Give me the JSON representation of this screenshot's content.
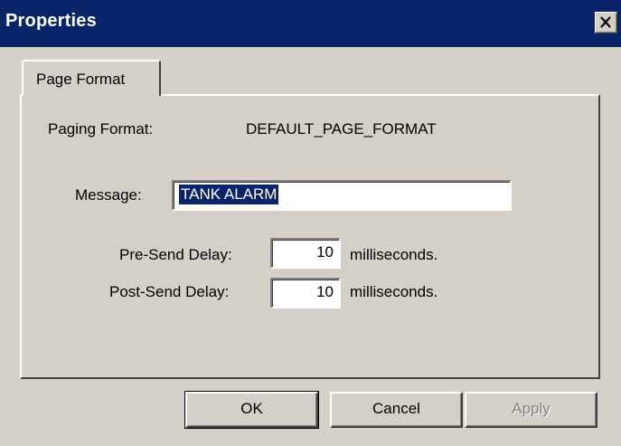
{
  "window": {
    "title": "Properties",
    "close_icon": "close-icon"
  },
  "tabs": [
    {
      "label": "Page Format",
      "selected": true
    }
  ],
  "page_format": {
    "paging_format_label": "Paging Format:",
    "paging_format_value": "DEFAULT_PAGE_FORMAT",
    "message_label": "Message:",
    "message_value": "TANK ALARM",
    "pre_send_delay_label": "Pre-Send Delay:",
    "pre_send_delay_value": "10",
    "pre_send_delay_unit": "milliseconds.",
    "post_send_delay_label": "Post-Send Delay:",
    "post_send_delay_value": "10",
    "post_send_delay_unit": "milliseconds."
  },
  "buttons": {
    "ok": "OK",
    "cancel": "Cancel",
    "apply": "Apply"
  },
  "colors": {
    "titlebar": "#0a246a",
    "face": "#d4d0c8",
    "selection": "#0a246a"
  }
}
